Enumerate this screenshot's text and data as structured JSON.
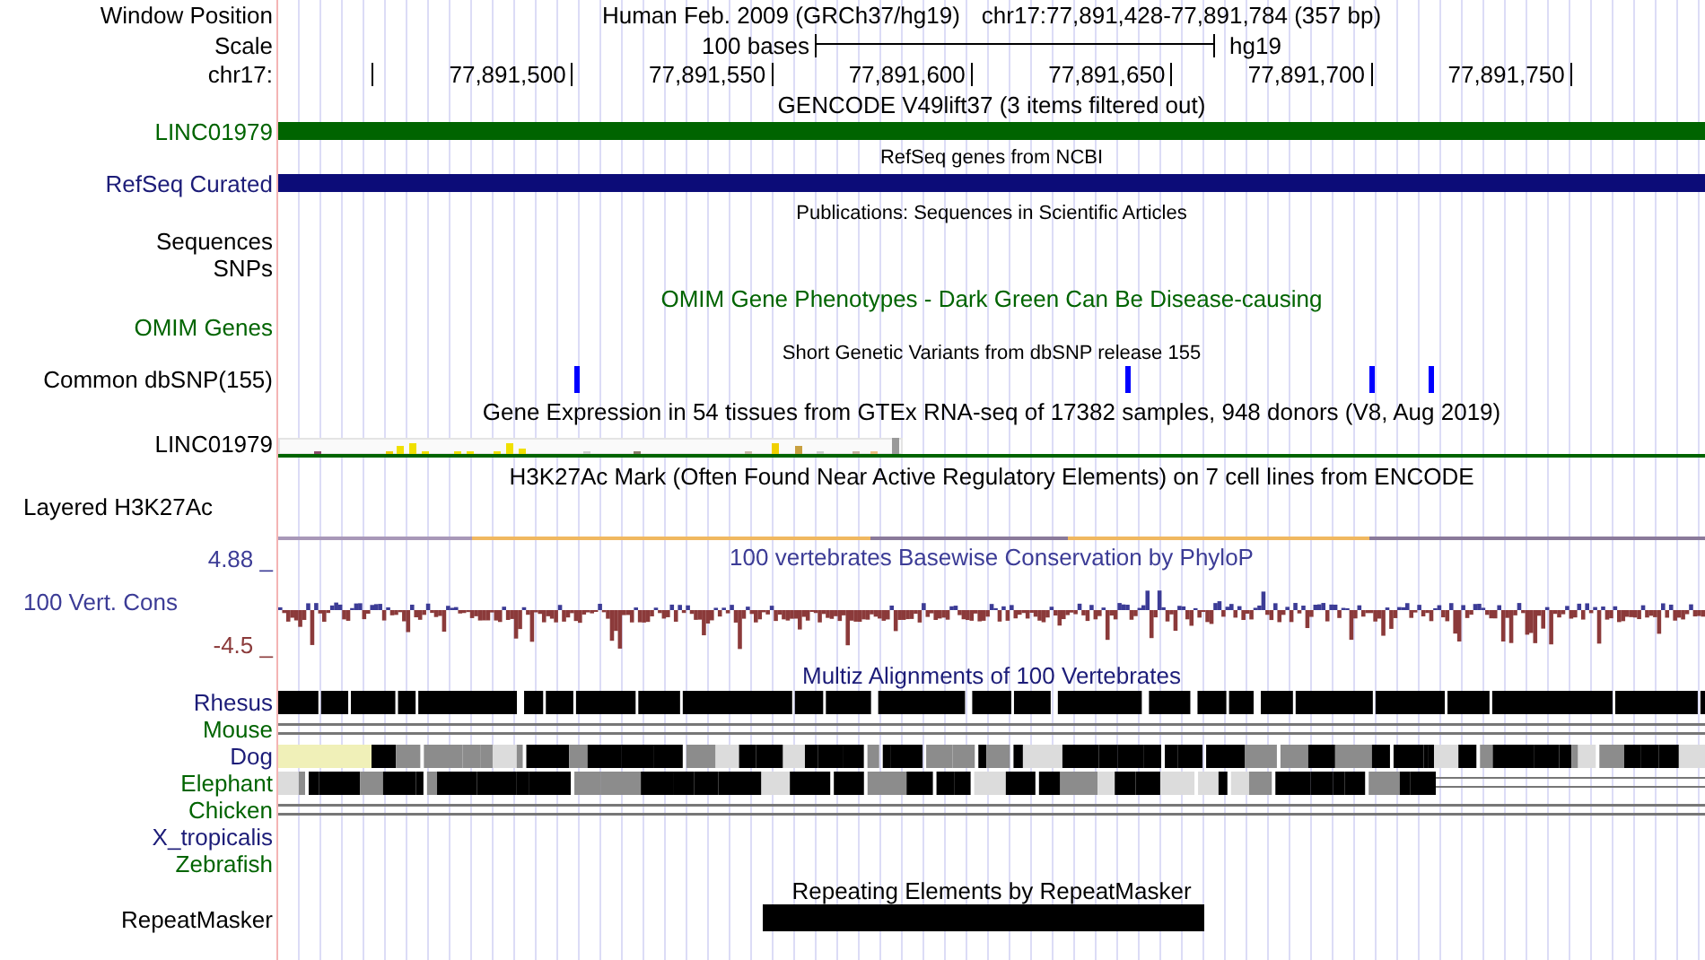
{
  "header": {
    "position_label": "Window Position",
    "assembly": "Human Feb. 2009 (GRCh37/hg19)",
    "position": "chr17:77,891,428-77,891,784 (357 bp)",
    "scale_label": "Scale",
    "scale_bases": "100 bases",
    "scale_assembly": "hg19",
    "chrom_label": "chr17:",
    "ruler_ticks": [
      "77,891,500",
      "77,891,550",
      "77,891,600",
      "77,891,650",
      "77,891,700",
      "77,891,750"
    ]
  },
  "gencode": {
    "title": "GENCODE V49lift37 (3 items filtered out)",
    "label": "LINC01979"
  },
  "refseq": {
    "title": "RefSeq genes from NCBI",
    "label": "RefSeq Curated"
  },
  "publications": {
    "title": "Publications: Sequences in Scientific Articles",
    "labels": [
      "Sequences",
      "SNPs"
    ]
  },
  "omim": {
    "title": "OMIM Gene Phenotypes - Dark Green Can Be Disease-causing",
    "label": "OMIM Genes"
  },
  "dbsnp": {
    "title": "Short Genetic Variants from dbSNP release 155",
    "label": "Common dbSNP(155)"
  },
  "gtex": {
    "title": "Gene Expression in 54 tissues from GTEx RNA-seq of 17382 samples, 948 donors (V8, Aug 2019)",
    "label": "LINC01979"
  },
  "h3k27ac": {
    "title": "H3K27Ac Mark (Often Found Near Active Regulatory Elements) on 7 cell lines from ENCODE",
    "label": "Layered H3K27Ac"
  },
  "phylop": {
    "title": "100 vertebrates Basewise Conservation by PhyloP",
    "label": "100 Vert. Cons",
    "max_label": "4.88 _",
    "min_label": "-4.5 _"
  },
  "multiz": {
    "title": "Multiz Alignments of 100 Vertebrates",
    "species": [
      {
        "name": "Rhesus",
        "color": "#1c1c78",
        "kind": "blocks"
      },
      {
        "name": "Mouse",
        "color": "#006400",
        "kind": "lines"
      },
      {
        "name": "Dog",
        "color": "#1c1c78",
        "kind": "blocks",
        "lead_unaligned": true
      },
      {
        "name": "Elephant",
        "color": "#006400",
        "kind": "blocks",
        "trailing_lines": true
      },
      {
        "name": "Chicken",
        "color": "#006400",
        "kind": "lines"
      },
      {
        "name": "X_tropicalis",
        "color": "#1c1c78",
        "kind": "none"
      },
      {
        "name": "Zebrafish",
        "color": "#006400",
        "kind": "none"
      }
    ]
  },
  "repeatmasker": {
    "title": "Repeating Elements by RepeatMasker",
    "label": "RepeatMasker"
  }
}
